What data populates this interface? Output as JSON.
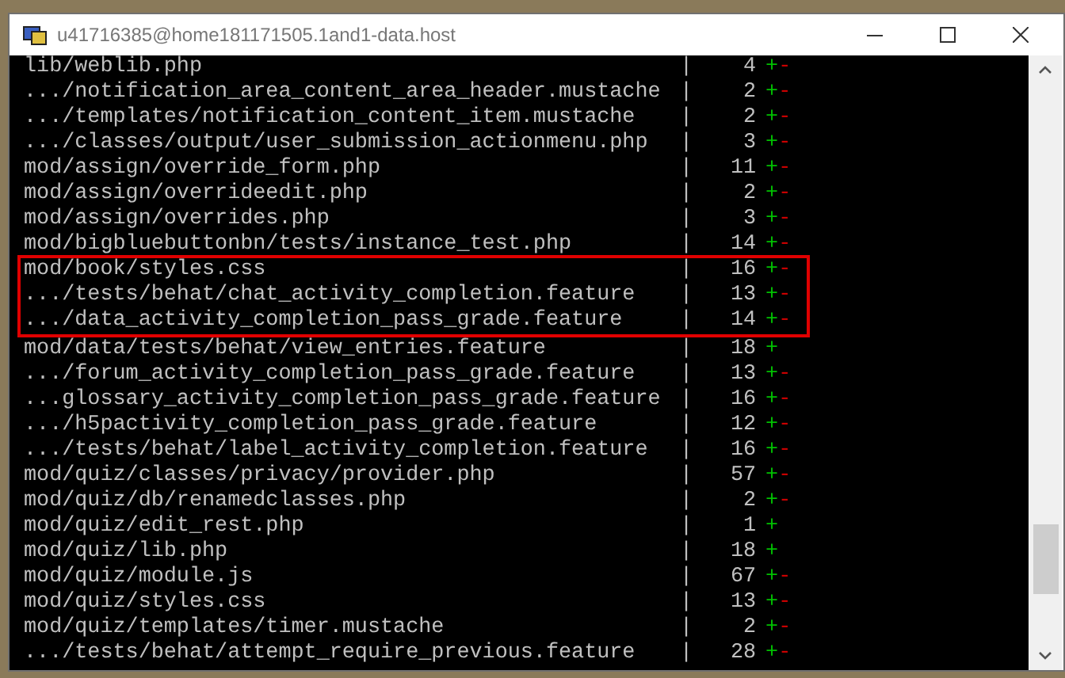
{
  "window": {
    "title": "u41716385@home181171505.1and1-data.host"
  },
  "rows": [
    {
      "path": "lib/weblib.php",
      "sep": "|",
      "count": "4",
      "plus": "+",
      "minus": "-",
      "highlighted": false
    },
    {
      "path": ".../notification_area_content_area_header.mustache",
      "sep": "|",
      "count": "2",
      "plus": "+",
      "minus": "-",
      "highlighted": false
    },
    {
      "path": ".../templates/notification_content_item.mustache",
      "sep": "|",
      "count": "2",
      "plus": "+",
      "minus": "-",
      "highlighted": false
    },
    {
      "path": ".../classes/output/user_submission_actionmenu.php",
      "sep": "|",
      "count": "3",
      "plus": "+",
      "minus": "-",
      "highlighted": false
    },
    {
      "path": "mod/assign/override_form.php",
      "sep": "|",
      "count": "11",
      "plus": "+",
      "minus": "-",
      "highlighted": false
    },
    {
      "path": "mod/assign/overrideedit.php",
      "sep": "|",
      "count": "2",
      "plus": "+",
      "minus": "-",
      "highlighted": false
    },
    {
      "path": "mod/assign/overrides.php",
      "sep": "|",
      "count": "3",
      "plus": "+",
      "minus": "-",
      "highlighted": false
    },
    {
      "path": "mod/bigbluebuttonbn/tests/instance_test.php",
      "sep": "|",
      "count": "14",
      "plus": "+",
      "minus": "-",
      "highlighted": false
    },
    {
      "path": "mod/book/styles.css",
      "sep": "|",
      "count": "16",
      "plus": "+",
      "minus": "-",
      "highlighted": true
    },
    {
      "path": ".../tests/behat/chat_activity_completion.feature",
      "sep": "|",
      "count": "13",
      "plus": "+",
      "minus": "-",
      "highlighted": true
    },
    {
      "path": ".../data_activity_completion_pass_grade.feature",
      "sep": "|",
      "count": "14",
      "plus": "+",
      "minus": "-",
      "highlighted": true
    },
    {
      "path": "mod/data/tests/behat/view_entries.feature",
      "sep": "|",
      "count": "18",
      "plus": "+",
      "highlighted": false
    },
    {
      "path": ".../forum_activity_completion_pass_grade.feature",
      "sep": "|",
      "count": "13",
      "plus": "+",
      "minus": "-",
      "highlighted": false
    },
    {
      "path": "...glossary_activity_completion_pass_grade.feature",
      "sep": "|",
      "count": "16",
      "plus": "+",
      "minus": "-",
      "highlighted": false
    },
    {
      "path": ".../h5pactivity_completion_pass_grade.feature",
      "sep": "|",
      "count": "12",
      "plus": "+",
      "minus": "-",
      "highlighted": false
    },
    {
      "path": ".../tests/behat/label_activity_completion.feature",
      "sep": "|",
      "count": "16",
      "plus": "+",
      "minus": "-",
      "highlighted": false
    },
    {
      "path": "mod/quiz/classes/privacy/provider.php",
      "sep": "|",
      "count": "57",
      "plus": "+",
      "minus": "-",
      "highlighted": false
    },
    {
      "path": "mod/quiz/db/renamedclasses.php",
      "sep": "|",
      "count": "2",
      "plus": "+",
      "minus": "-",
      "highlighted": false
    },
    {
      "path": "mod/quiz/edit_rest.php",
      "sep": "|",
      "count": "1",
      "plus": "+",
      "highlighted": false
    },
    {
      "path": "mod/quiz/lib.php",
      "sep": "|",
      "count": "18",
      "plus": "+",
      "highlighted": false
    },
    {
      "path": "mod/quiz/module.js",
      "sep": "|",
      "count": "67",
      "plus": "+",
      "minus": "-",
      "highlighted": false
    },
    {
      "path": "mod/quiz/styles.css",
      "sep": "|",
      "count": "13",
      "plus": "+",
      "minus": "-",
      "highlighted": false
    },
    {
      "path": "mod/quiz/templates/timer.mustache",
      "sep": "|",
      "count": "2",
      "plus": "+",
      "minus": "-",
      "highlighted": false
    },
    {
      "path": ".../tests/behat/attempt_require_previous.feature",
      "sep": "|",
      "count": "28",
      "plus": "+",
      "minus": "-",
      "highlighted": false
    }
  ]
}
